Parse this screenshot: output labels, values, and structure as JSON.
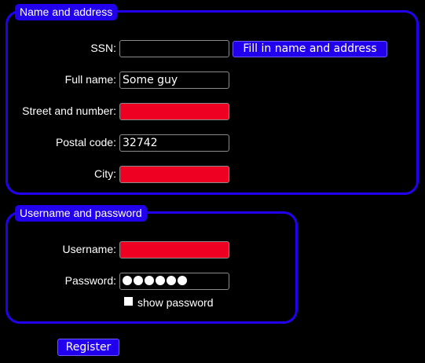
{
  "name_address": {
    "legend": "Name and address",
    "ssn_label": "SSN:",
    "ssn_value": "",
    "fill_button": "Fill in name and address",
    "fullname_label": "Full name:",
    "fullname_value": "Some guy",
    "street_label": "Street and number:",
    "street_value": "",
    "postal_label": "Postal code:",
    "postal_value": "32742",
    "city_label": "City:",
    "city_value": ""
  },
  "credentials": {
    "legend": "Username and password",
    "username_label": "Username:",
    "username_value": "",
    "password_label": "Password:",
    "password_length": 6,
    "show_password_label": "show password",
    "show_password_checked": false
  },
  "register_button": "Register",
  "colors": {
    "accent": "#2200ee",
    "error": "#ee0022",
    "background": "#000000",
    "text": "#ffffff"
  }
}
